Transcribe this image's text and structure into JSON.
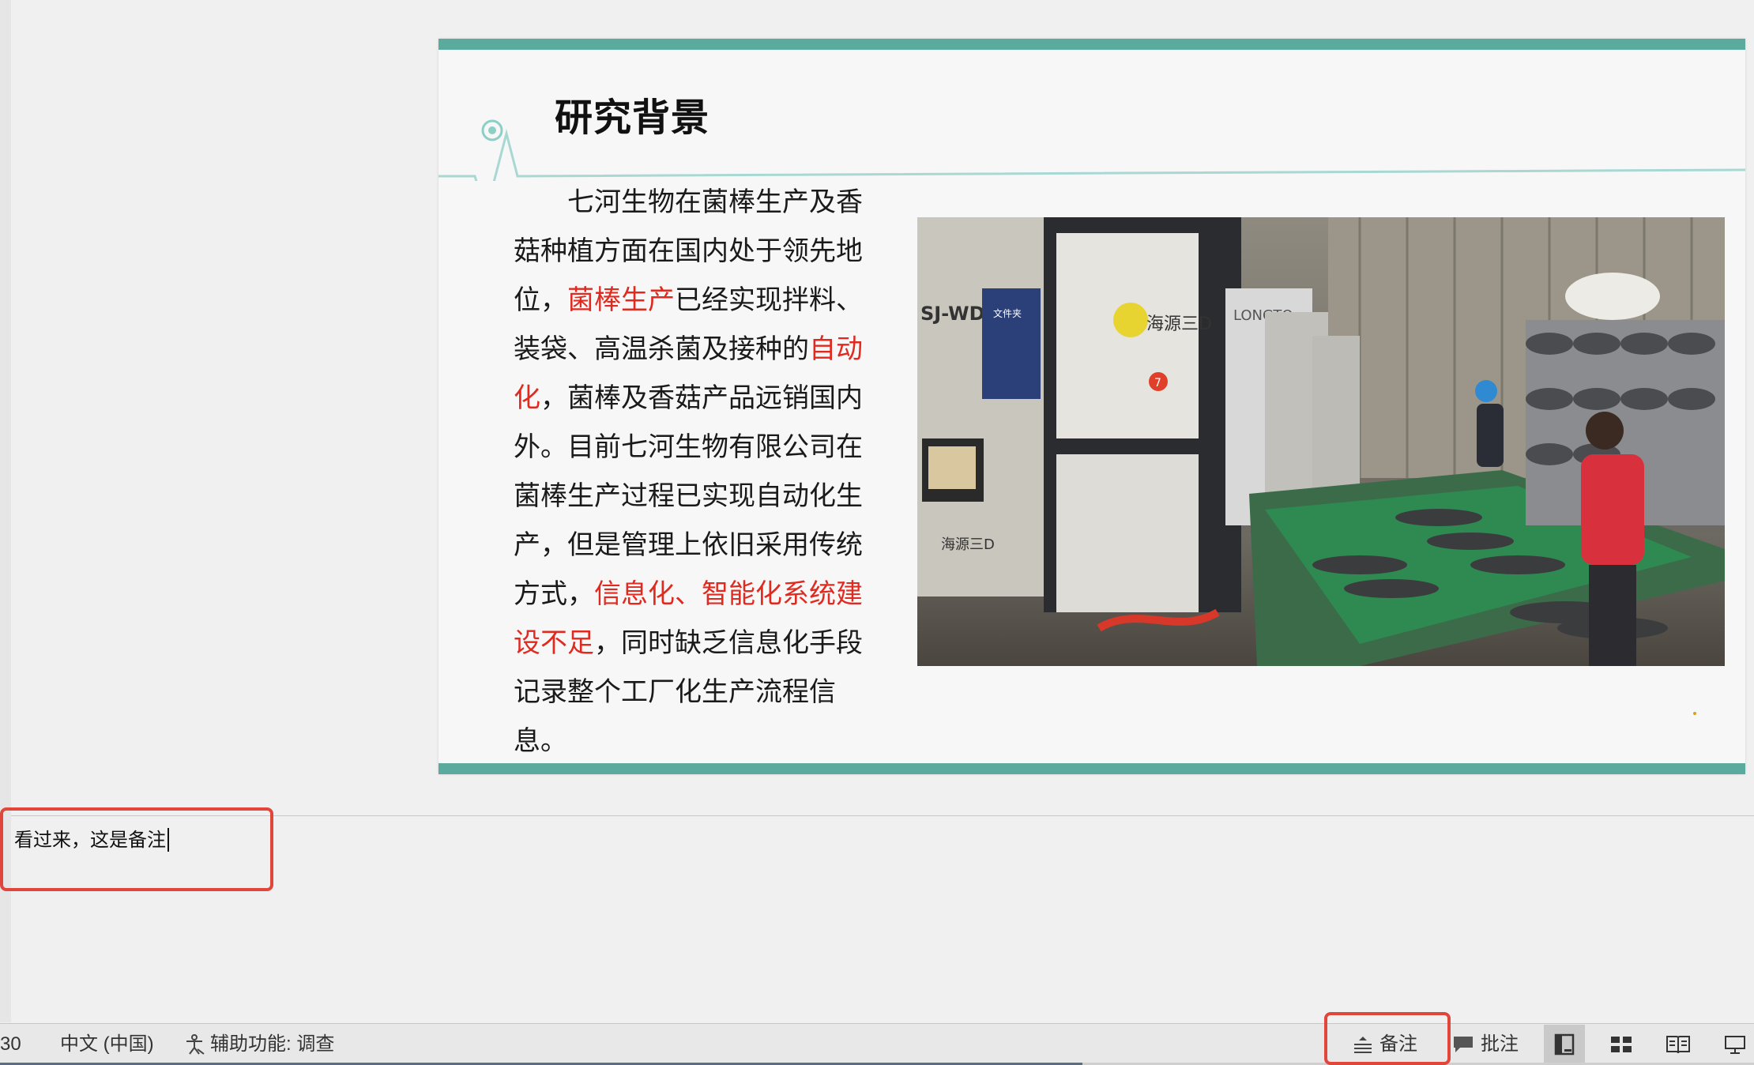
{
  "slide": {
    "title": "研究背景",
    "body_segments": [
      {
        "text": "七河生物在菌棒生产及香菇种植方面在国内处于领先地位，",
        "highlight": false
      },
      {
        "text": "菌棒生产",
        "highlight": true
      },
      {
        "text": "已经实现拌料、装袋、高温杀菌及接种的",
        "highlight": false
      },
      {
        "text": "自动化",
        "highlight": true
      },
      {
        "text": "，菌棒及香菇产品远销国内外。目前七河生物有限公司在菌棒生产过程已实现自动化生产，但是管理上依旧采用传统方式，",
        "highlight": false
      },
      {
        "text": "信息化、智能化系统建设不足",
        "highlight": true
      },
      {
        "text": "，同时缺乏信息化手段记录整个工厂化生产流程信息。",
        "highlight": false
      }
    ],
    "colors": {
      "accent_bar": "#5aab9e",
      "highlight": "#e02a20"
    },
    "photo": {
      "icon": "factory-photo",
      "machine_labels": {
        "brand_a": "SJ-WD",
        "brand_b": "海源三D",
        "brand_c": "LONGTO",
        "folder_tag": "文件夹",
        "badge": "7"
      }
    }
  },
  "notes": {
    "text": "看过来，这是备注"
  },
  "statusbar": {
    "page_indicator": "30",
    "language": "中文 (中国)",
    "accessibility": "辅助功能: 调查",
    "notes_button": "备注",
    "comments_button": "批注",
    "views": [
      {
        "name": "normal-view-icon",
        "active": true
      },
      {
        "name": "slide-sorter-icon",
        "active": false
      },
      {
        "name": "reading-view-icon",
        "active": false
      },
      {
        "name": "slideshow-icon",
        "active": false
      }
    ]
  },
  "callout_color": "#e0463a"
}
